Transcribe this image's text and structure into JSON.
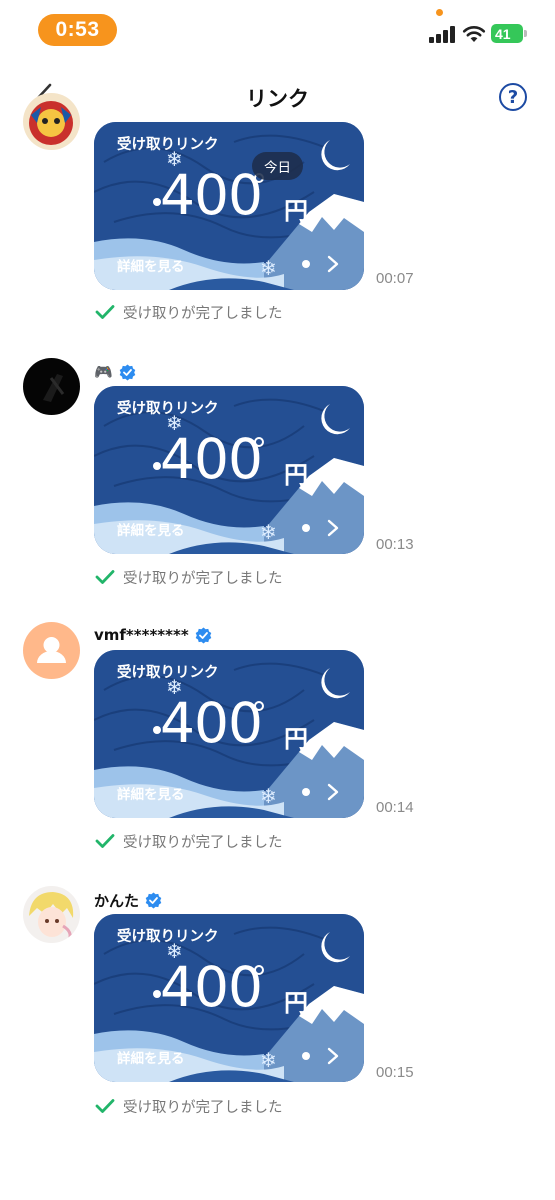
{
  "status_bar": {
    "time": "0:53",
    "battery": "41"
  },
  "header": {
    "title": "リンク",
    "back_icon": "chevron-left-icon",
    "help_symbol": "?"
  },
  "today_label": "今日",
  "messages": [
    {
      "sender": "",
      "avatar": "cartoon-mascot",
      "card": {
        "label": "受け取りリンク",
        "amount": "400",
        "unit": "円",
        "detail": "詳細を見る"
      },
      "time": "00:07",
      "status": "受け取りが完了しました"
    },
    {
      "sender": "🎮",
      "avatar": "dark-photo",
      "card": {
        "label": "受け取りリンク",
        "amount": "400",
        "unit": "円",
        "detail": "詳細を見る"
      },
      "time": "00:13",
      "status": "受け取りが完了しました"
    },
    {
      "sender": "vmf********",
      "avatar": "default-person",
      "card": {
        "label": "受け取りリンク",
        "amount": "400",
        "unit": "円",
        "detail": "詳細を見る"
      },
      "time": "00:14",
      "status": "受け取りが完了しました"
    },
    {
      "sender": "かんた",
      "avatar": "anime-character",
      "card": {
        "label": "受け取りリンク",
        "amount": "400",
        "unit": "円",
        "detail": "詳細を見る"
      },
      "time": "00:15",
      "status": "受け取りが完了しました"
    }
  ],
  "colors": {
    "card_bg": "#244f93",
    "accent_blue": "#1c4aa3",
    "check_green": "#22b56a",
    "time_pill": "#f7941d",
    "verified_blue": "#2d8cf0"
  }
}
